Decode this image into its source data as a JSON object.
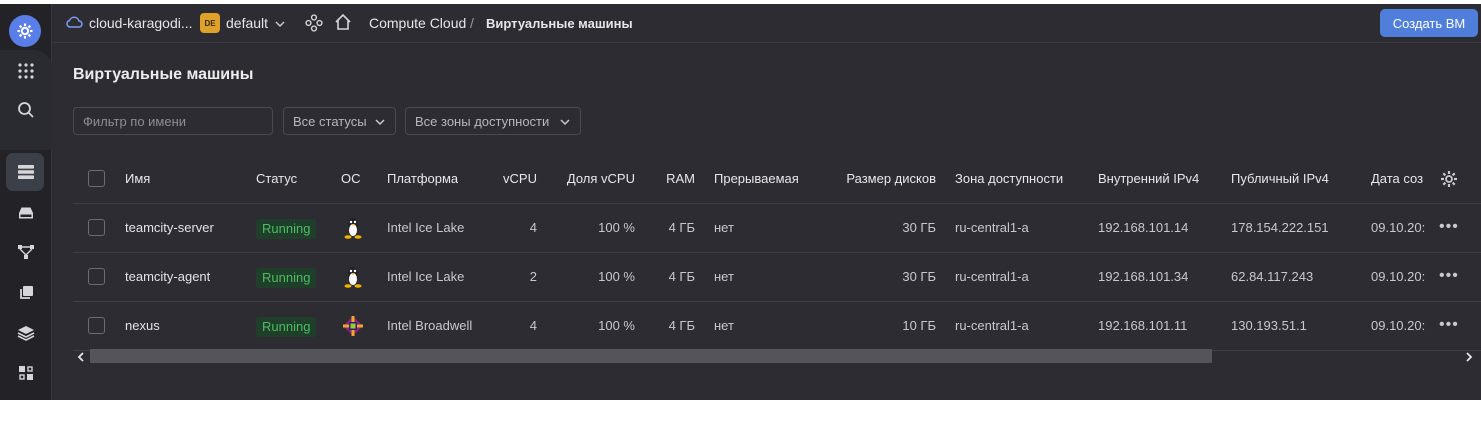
{
  "topbar": {
    "cloud_name": "cloud-karagodi...",
    "folder_badge": "DE",
    "folder_name": "default",
    "service": "Compute Cloud",
    "separator": "/",
    "current_page": "Виртуальные машины",
    "create_button": "Создать ВМ"
  },
  "page": {
    "title": "Виртуальные машины",
    "filter_placeholder": "Фильтр по имени",
    "status_select": "Все статусы",
    "zone_select": "Все зоны доступности"
  },
  "table": {
    "headers": {
      "name": "Имя",
      "status": "Статус",
      "os": "ОС",
      "platform": "Платформа",
      "vcpu": "vCPU",
      "vcpu_share": "Доля vCPU",
      "ram": "RAM",
      "preemptible": "Прерываемая",
      "disk_size": "Размер дисков",
      "zone": "Зона доступности",
      "internal_ip": "Внутренний IPv4",
      "public_ip": "Публичный IPv4",
      "created": "Дата соз"
    },
    "rows": [
      {
        "name": "teamcity-server",
        "status": "Running",
        "os_icon": "linux-tux-icon",
        "platform": "Intel Ice Lake",
        "vcpu": "4",
        "vcpu_share": "100 %",
        "ram": "4 ГБ",
        "preemptible": "нет",
        "disk_size": "30 ГБ",
        "zone": "ru-central1-a",
        "internal_ip": "192.168.101.14",
        "public_ip": "178.154.222.151",
        "created": "09.10.20:"
      },
      {
        "name": "teamcity-agent",
        "status": "Running",
        "os_icon": "linux-tux-icon",
        "platform": "Intel Ice Lake",
        "vcpu": "2",
        "vcpu_share": "100 %",
        "ram": "4 ГБ",
        "preemptible": "нет",
        "disk_size": "30 ГБ",
        "zone": "ru-central1-a",
        "internal_ip": "192.168.101.34",
        "public_ip": "62.84.117.243",
        "created": "09.10.20:"
      },
      {
        "name": "nexus",
        "status": "Running",
        "os_icon": "centos-icon",
        "platform": "Intel Broadwell",
        "vcpu": "4",
        "vcpu_share": "100 %",
        "ram": "4 ГБ",
        "preemptible": "нет",
        "disk_size": "10 ГБ",
        "zone": "ru-central1-a",
        "internal_ip": "192.168.101.11",
        "public_ip": "130.193.51.1",
        "created": "09.10.20:"
      }
    ]
  },
  "colors": {
    "background": "#2d2c33",
    "rail": "#232227",
    "accent": "#4f7fdb",
    "running": "#4cbc62",
    "folder_badge": "#e0a12a"
  }
}
